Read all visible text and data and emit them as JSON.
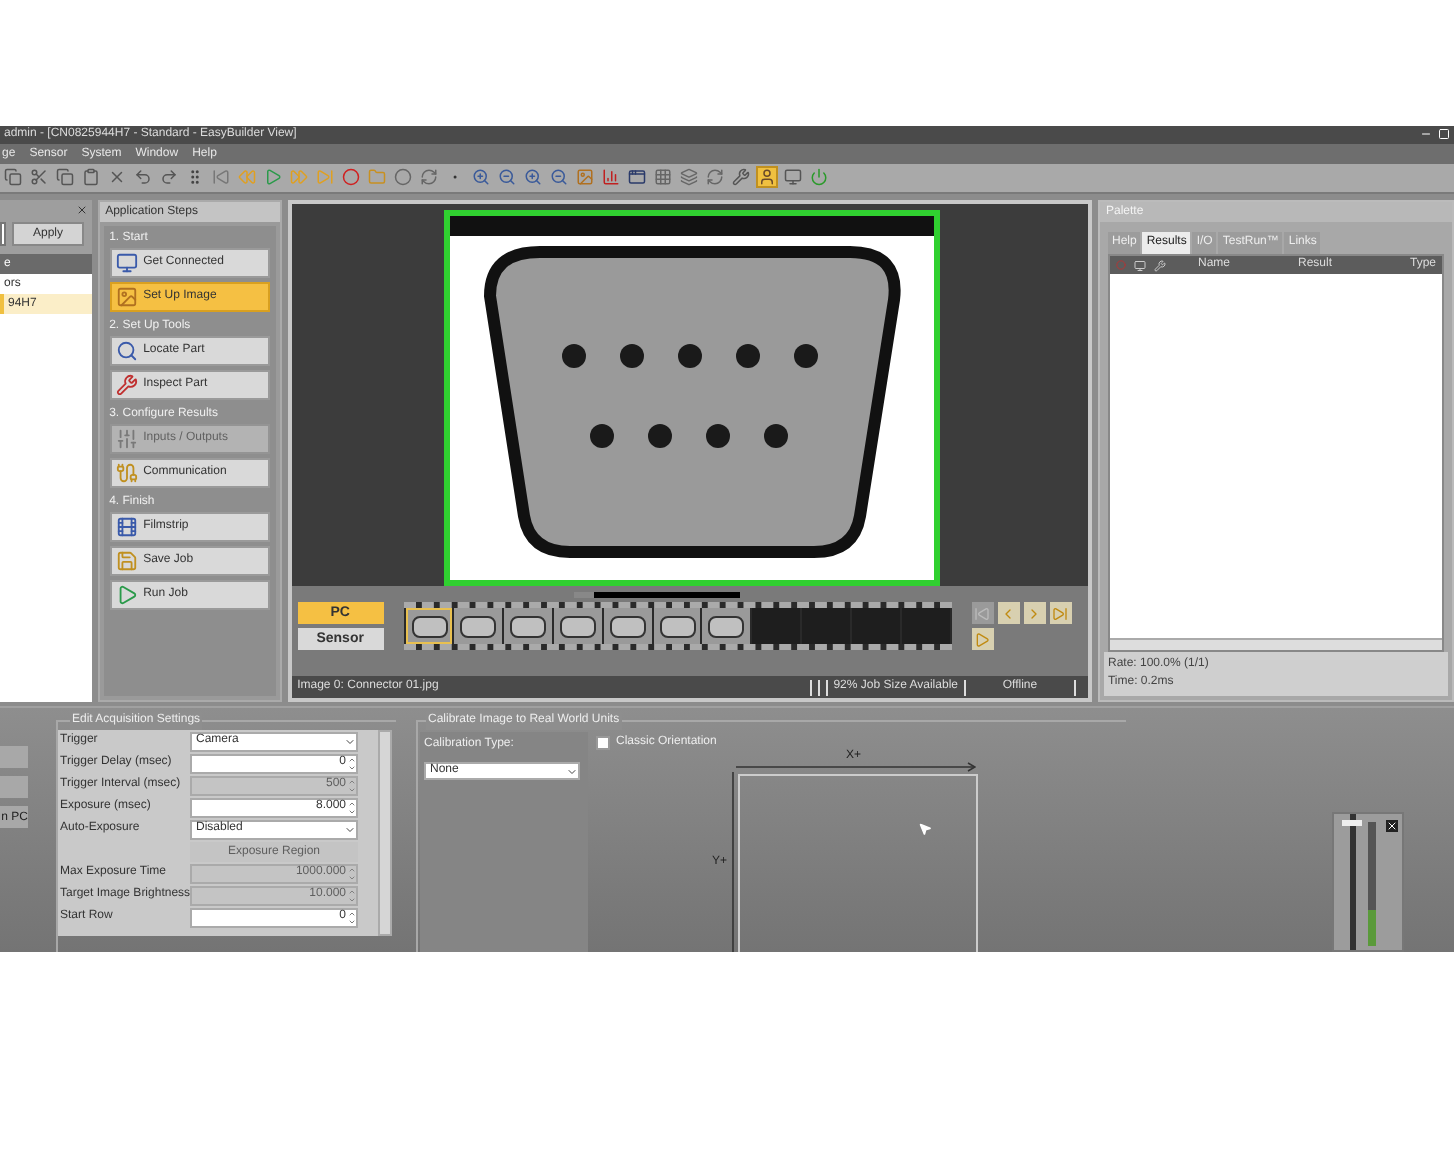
{
  "window": {
    "title": "admin - [CN0825944H7 - Standard - EasyBuilder View]"
  },
  "menu": [
    "ge",
    "Sensor",
    "System",
    "Window",
    "Help"
  ],
  "toolbar": [
    {
      "kind": "copy",
      "selected": false
    },
    {
      "kind": "cut",
      "selected": false
    },
    {
      "kind": "copy",
      "selected": false
    },
    {
      "kind": "paste",
      "selected": false
    },
    {
      "kind": "delete",
      "selected": false
    },
    {
      "kind": "undo",
      "selected": false
    },
    {
      "kind": "redo",
      "selected": false
    },
    {
      "kind": "grip",
      "selected": false
    },
    {
      "kind": "first",
      "selected": false
    },
    {
      "kind": "rewind",
      "selected": false
    },
    {
      "kind": "play",
      "selected": false
    },
    {
      "kind": "forward",
      "selected": false
    },
    {
      "kind": "last",
      "selected": false
    },
    {
      "kind": "record",
      "selected": false
    },
    {
      "kind": "folder",
      "selected": false
    },
    {
      "kind": "circle",
      "selected": false
    },
    {
      "kind": "refresh",
      "selected": false
    },
    {
      "kind": "dot",
      "selected": false
    },
    {
      "kind": "zoom-in",
      "selected": false
    },
    {
      "kind": "zoom-out",
      "selected": false
    },
    {
      "kind": "zoom-in",
      "selected": false
    },
    {
      "kind": "zoom-out",
      "selected": false
    },
    {
      "kind": "image",
      "selected": false
    },
    {
      "kind": "chart",
      "selected": false
    },
    {
      "kind": "window",
      "selected": false
    },
    {
      "kind": "grid",
      "selected": false
    },
    {
      "kind": "layers",
      "selected": false
    },
    {
      "kind": "refresh",
      "selected": false
    },
    {
      "kind": "tool",
      "selected": false
    },
    {
      "kind": "user",
      "selected": true
    },
    {
      "kind": "monitor",
      "selected": false
    },
    {
      "kind": "power",
      "selected": false
    }
  ],
  "left_panel": {
    "apply_button": "Apply",
    "items": [
      {
        "label": "e",
        "selected": true,
        "active": false
      },
      {
        "label": "ors",
        "selected": false,
        "active": false
      },
      {
        "label": "94H7",
        "selected": false,
        "active": true
      }
    ]
  },
  "application_steps": {
    "title": "Application Steps",
    "sections": [
      {
        "title": "1. Start",
        "steps": [
          {
            "label": "Get Connected",
            "kind": "connect",
            "selected": false,
            "disabled": false
          },
          {
            "label": "Set Up Image",
            "kind": "image",
            "selected": true,
            "disabled": false
          }
        ]
      },
      {
        "title": "2. Set Up Tools",
        "steps": [
          {
            "label": "Locate Part",
            "kind": "locate",
            "selected": false,
            "disabled": false
          },
          {
            "label": "Inspect Part",
            "kind": "inspect",
            "selected": false,
            "disabled": false
          }
        ]
      },
      {
        "title": "3. Configure Results",
        "steps": [
          {
            "label": "Inputs / Outputs",
            "kind": "io",
            "selected": false,
            "disabled": true
          },
          {
            "label": "Communication",
            "kind": "communication",
            "selected": false,
            "disabled": false
          }
        ]
      },
      {
        "title": "4. Finish",
        "steps": [
          {
            "label": "Filmstrip",
            "kind": "filmstrip",
            "selected": false,
            "disabled": false
          },
          {
            "label": "Save Job",
            "kind": "save",
            "selected": false,
            "disabled": false
          },
          {
            "label": "Run Job",
            "kind": "run",
            "selected": false,
            "disabled": false
          }
        ]
      }
    ]
  },
  "image_view": {
    "mode_buttons": [
      {
        "label": "PC",
        "selected": true
      },
      {
        "label": "Sensor",
        "selected": false
      }
    ],
    "filmstrip": [
      {
        "filled": true,
        "selected": true
      },
      {
        "filled": true,
        "selected": false
      },
      {
        "filled": true,
        "selected": false
      },
      {
        "filled": true,
        "selected": false
      },
      {
        "filled": true,
        "selected": false
      },
      {
        "filled": true,
        "selected": false
      },
      {
        "filled": true,
        "selected": false
      },
      {
        "filled": false,
        "selected": false
      },
      {
        "filled": false,
        "selected": false
      },
      {
        "filled": false,
        "selected": false
      },
      {
        "filled": false,
        "selected": false
      }
    ],
    "nav_buttons": [
      {
        "kind": "first",
        "disabled": true
      },
      {
        "kind": "prev",
        "disabled": false
      },
      {
        "kind": "next",
        "disabled": false
      },
      {
        "kind": "last",
        "disabled": false
      },
      {
        "kind": "play",
        "disabled": false
      }
    ],
    "status_bar": {
      "image": "Image 0: Connector 01.jpg",
      "job_size": "92% Job Size Available",
      "connection": "Offline"
    }
  },
  "palette": {
    "title": "Palette",
    "tabs": [
      {
        "label": "Help",
        "selected": false
      },
      {
        "label": "Results",
        "selected": true
      },
      {
        "label": "I/O",
        "selected": false
      },
      {
        "label": "TestRun™",
        "selected": false
      },
      {
        "label": "Links",
        "selected": false
      }
    ],
    "columns": [
      "Name",
      "Result",
      "Type"
    ],
    "rate": "Rate: 100.0% (1/1)",
    "time": "Time: 0.2ms"
  },
  "side_panel": {
    "buttons": [
      {
        "kind": "blank"
      },
      {
        "kind": "blank"
      },
      {
        "kind": "labeled",
        "label": "n PC"
      }
    ]
  },
  "acquisition": {
    "title": "Edit Acquisition Settings",
    "rows": [
      {
        "label": "Trigger",
        "kind": "dropdown",
        "value": "Camera",
        "disabled": false
      },
      {
        "label": "Trigger Delay (msec)",
        "kind": "spinner",
        "value": "0",
        "disabled": false
      },
      {
        "label": "Trigger Interval (msec)",
        "kind": "spinner",
        "value": "500",
        "disabled": true
      },
      {
        "label": "Exposure (msec)",
        "kind": "spinner",
        "value": "8.000",
        "disabled": false
      },
      {
        "label": "Auto-Exposure",
        "kind": "dropdown",
        "value": "Disabled",
        "disabled": false
      },
      {
        "kind": "button",
        "value": "Exposure Region",
        "disabled": true
      },
      {
        "label": "Max Exposure Time",
        "kind": "spinner",
        "value": "1000.000",
        "disabled": true
      },
      {
        "label": "Target Image Brightness",
        "kind": "spinner",
        "value": "10.000",
        "disabled": true
      },
      {
        "label": "Start Row",
        "kind": "spinner",
        "value": "0",
        "disabled": false
      }
    ]
  },
  "calibration": {
    "title": "Calibrate Image to Real World Units",
    "type_label": "Calibration Type:",
    "type_value": "None",
    "classic_orientation": {
      "label": "Classic Orientation",
      "checked": false
    },
    "x_axis": "X+",
    "y_axis": "Y+"
  },
  "slider": {
    "level": 0.95
  }
}
